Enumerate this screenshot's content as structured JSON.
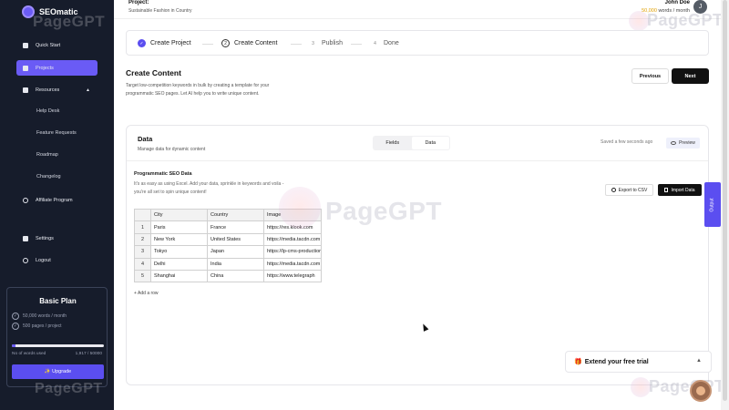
{
  "brand": {
    "name": "SEOmatic",
    "watermark": "PageGPT"
  },
  "sidebar": {
    "items": [
      {
        "label": "Quick Start",
        "icon": "flag-icon"
      },
      {
        "label": "Projects",
        "icon": "folder-icon",
        "active": true
      },
      {
        "label": "Resources",
        "icon": "book-icon"
      },
      {
        "label": "Affiliate Program",
        "icon": "affiliate-icon"
      },
      {
        "label": "Settings",
        "icon": "gear-icon"
      },
      {
        "label": "Logout",
        "icon": "logout-icon"
      }
    ],
    "sub_items": [
      "Help Desk",
      "Feature Requests",
      "Roadmap",
      "Changelog"
    ]
  },
  "plan": {
    "title": "Basic Plan",
    "features": [
      "50,000 words / month",
      "500 pages / project"
    ],
    "usage_label": "No of words used",
    "usage_value": "1,917 / 50000",
    "usage_fraction": 0.04,
    "upgrade_label": "✨ Upgrade"
  },
  "header": {
    "project_label": "Project:",
    "project_name": "Sustainable Fashion in Country",
    "user_name": "John Doe",
    "words_count": "50,000",
    "words_suffix": " words / month",
    "avatar_initial": "J"
  },
  "stepper": {
    "steps": [
      {
        "label": "Create Project",
        "badge": "✓",
        "state": "done"
      },
      {
        "label": "Create Content",
        "badge": "2",
        "state": "current"
      },
      {
        "label": "Publish",
        "badge": "3",
        "state": "todo"
      },
      {
        "label": "Done",
        "badge": "4",
        "state": "todo"
      }
    ]
  },
  "create_content": {
    "title": "Create Content",
    "description": "Target low-competition keywords in bulk by creating a template for your programmatic SEO pages.  Let AI help you to write unique content.",
    "prev_label": "Previous",
    "next_label": "Next"
  },
  "data_card": {
    "title": "Data",
    "subtitle": "Manage data for dynamic content",
    "toggle": [
      "Fields",
      "Data"
    ],
    "toggle_active": "Data",
    "saved_text": "Saved a few seconds ago",
    "preview_label": "Preview",
    "pseo_title": "Programmatic SEO Data",
    "pseo_desc": "It's as easy as using Excel. Add your data, sprinkle in keywords and voila - you're all set to spin unique content!",
    "export_label": "Export to CSV",
    "import_label": "Import Data",
    "add_row_label": "+ Add a row"
  },
  "table": {
    "columns": [
      "City",
      "Country",
      "Image"
    ],
    "rows": [
      {
        "n": "1",
        "cells": [
          "Paris",
          "France",
          "https://res.klook.com"
        ]
      },
      {
        "n": "2",
        "cells": [
          "New York",
          "United States",
          "https://media.tacdn.com"
        ]
      },
      {
        "n": "3",
        "cells": [
          "Tokyo",
          "Japan",
          "https://lp-cms-production"
        ]
      },
      {
        "n": "4",
        "cells": [
          "Delhi",
          "India",
          "https://media.tacdn.com"
        ]
      },
      {
        "n": "5",
        "cells": [
          "Shanghai",
          "China",
          "https://www.telegraph"
        ]
      }
    ]
  },
  "trial": {
    "label": "Extend your free trial",
    "icon": "gift-icon"
  },
  "output_tab": {
    "label": "Output"
  },
  "colors": {
    "accent": "#5b4ef0",
    "sidebar_bg": "#161c2b",
    "highlight": "#e0a000"
  }
}
